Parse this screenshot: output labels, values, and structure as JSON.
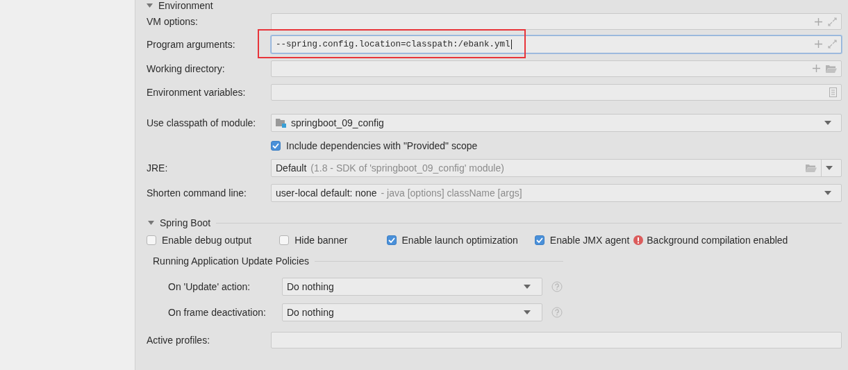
{
  "environment": {
    "title": "Environment",
    "expanded": true,
    "fields": [
      {
        "kind": "expandable",
        "label": "VM options:",
        "focused": false,
        "highlighted": false
      },
      {
        "kind": "expandable",
        "label": "Program arguments:",
        "value": "--spring.config.location=classpath:/ebank.yml",
        "focused": true,
        "highlighted": true
      },
      {
        "kind": "directory",
        "label": "Working directory:",
        "focused": false,
        "highlighted": false
      },
      {
        "kind": "variables",
        "label": "Environment variables:",
        "focused": false,
        "highlighted": false
      }
    ]
  },
  "module": {
    "label": "Use classpath of module:",
    "value": "springboot_09_config"
  },
  "include_provided": {
    "label": "Include dependencies with \"Provided\" scope",
    "checked": true
  },
  "jre": {
    "label": "JRE:",
    "value": "Default",
    "hint": "(1.8 - SDK of 'springboot_09_config' module)"
  },
  "shorten": {
    "label": "Shorten command line:",
    "value": "user-local default: none",
    "hint": "- java [options] className [args]"
  },
  "spring_boot": {
    "title": "Spring Boot",
    "expanded": true,
    "options": [
      {
        "label": "Enable debug output",
        "checked": false
      },
      {
        "label": "Hide banner",
        "checked": false
      },
      {
        "label": "Enable launch optimization",
        "checked": true
      },
      {
        "label": "Enable JMX agent",
        "checked": true
      }
    ],
    "warning": "Background compilation enabled",
    "policies": {
      "title": "Running Application Update Policies",
      "rows": [
        {
          "label": "On 'Update' action:",
          "value": "Do nothing"
        },
        {
          "label": "On frame deactivation:",
          "value": "Do nothing"
        }
      ]
    }
  },
  "active_profiles": {
    "label": "Active profiles:"
  }
}
